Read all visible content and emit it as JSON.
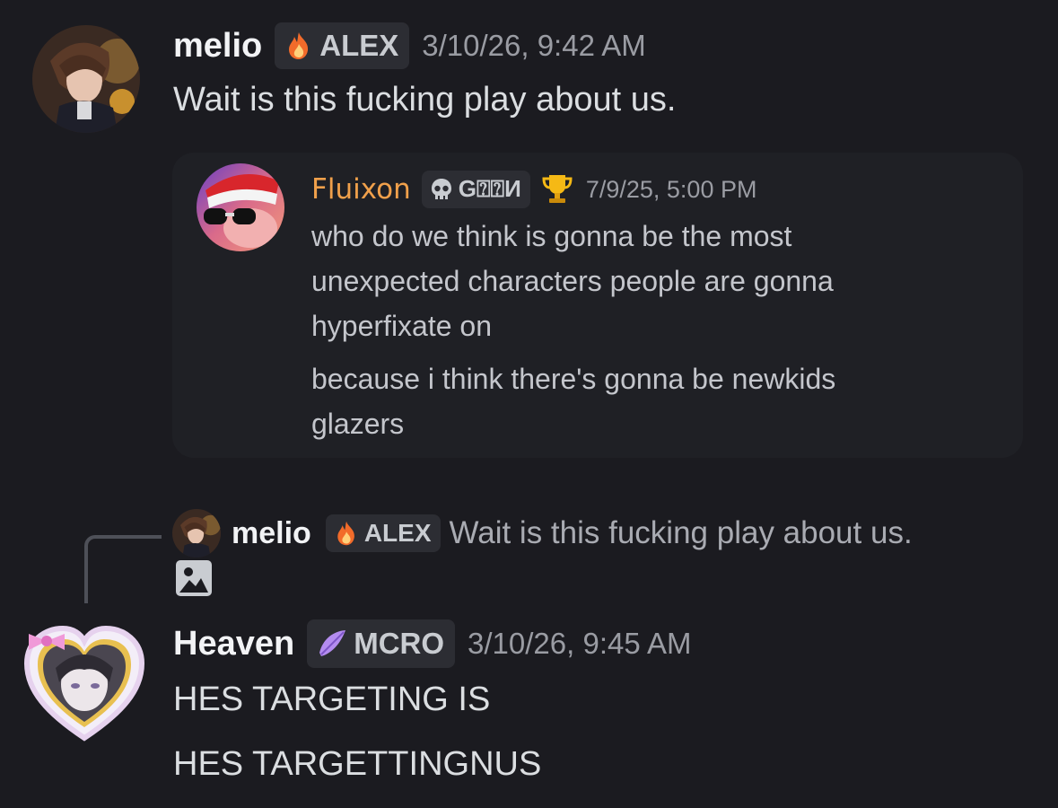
{
  "messages": [
    {
      "author": "melio",
      "tag": "ALEX",
      "tag_icon": "fire-icon",
      "timestamp": "3/10/26, 9:42 AM",
      "text": "Wait is this fucking play about us."
    },
    {
      "author": "Heaven",
      "tag": "MCRO",
      "tag_icon": "feather-icon",
      "timestamp": "3/10/26, 9:45 AM",
      "lines": [
        "HES TARGETING IS",
        "HES TARGETTINGNUS"
      ]
    }
  ],
  "embed": {
    "author": "Fluixon",
    "author_color": "#f0a04b",
    "tag": "G⍰⍰И",
    "tag_icon": "skull-icon",
    "trophy_icon": "trophy-icon",
    "timestamp": "7/9/25, 5:00 PM",
    "lines": [
      "who do we think is gonna be the most",
      "unexpected characters people are gonna",
      "hyperfixate on",
      "because i think there's gonna be newkids",
      "glazers"
    ]
  },
  "reply": {
    "author": "melio",
    "tag": "ALEX",
    "tag_icon": "fire-icon",
    "text": "Wait is this fucking play about us.",
    "attachment_icon": "image-icon"
  },
  "colors": {
    "background": "#1b1b20",
    "embed_background": "#1f2025",
    "fire": "#f26b2a",
    "feather": "#b48cf0"
  }
}
